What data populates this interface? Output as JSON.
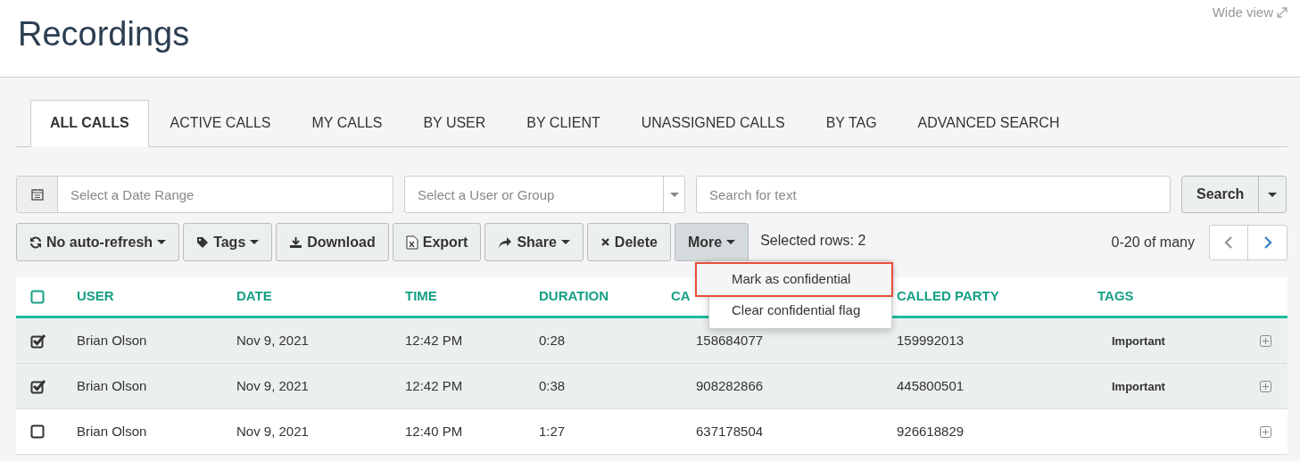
{
  "page": {
    "title": "Recordings",
    "wide_view": "Wide view"
  },
  "tabs": [
    {
      "label": "ALL CALLS",
      "selected": true
    },
    {
      "label": "ACTIVE CALLS",
      "selected": false
    },
    {
      "label": "MY CALLS",
      "selected": false
    },
    {
      "label": "BY USER",
      "selected": false
    },
    {
      "label": "BY CLIENT",
      "selected": false
    },
    {
      "label": "UNASSIGNED CALLS",
      "selected": false
    },
    {
      "label": "BY TAG",
      "selected": false
    },
    {
      "label": "ADVANCED SEARCH",
      "selected": false
    }
  ],
  "filters": {
    "date_range": {
      "placeholder": "Select a Date Range"
    },
    "user_group": {
      "placeholder": "Select a User or Group"
    },
    "text": {
      "placeholder": "Search for text"
    },
    "search_button": "Search"
  },
  "toolbar": [
    {
      "label": "No auto-refresh",
      "kind": "refresh",
      "caret": true,
      "active": false
    },
    {
      "label": "Tags",
      "kind": "tag",
      "caret": true,
      "active": false
    },
    {
      "label": "Download",
      "kind": "download",
      "caret": false,
      "active": false
    },
    {
      "label": "Export",
      "kind": "export",
      "caret": false,
      "active": false
    },
    {
      "label": "Share",
      "kind": "share",
      "caret": true,
      "active": false
    },
    {
      "label": "Delete",
      "kind": "delete",
      "caret": false,
      "active": false
    },
    {
      "label": "More",
      "kind": "more",
      "caret": true,
      "active": true
    }
  ],
  "selected_rows": "Selected rows: 2",
  "pagination": {
    "range": "0-20 of many",
    "prev_disabled": true
  },
  "more_menu": [
    {
      "label": "Mark as confidential",
      "highlighted": true
    },
    {
      "label": "Clear confidential flag",
      "highlighted": false
    }
  ],
  "table": {
    "all_checked": false,
    "columns": [
      "USER",
      "DATE",
      "TIME",
      "DURATION",
      "CA",
      "CALLED PARTY",
      "TAGS"
    ],
    "rows": [
      {
        "checked": true,
        "cells": [
          "Brian Olson",
          "Nov 9, 2021",
          "12:42 PM",
          "0:28",
          "158684077",
          "159992013"
        ],
        "tag": "Important"
      },
      {
        "checked": true,
        "cells": [
          "Brian Olson",
          "Nov 9, 2021",
          "12:42 PM",
          "0:38",
          "908282866",
          "445800501"
        ],
        "tag": "Important"
      },
      {
        "checked": false,
        "cells": [
          "Brian Olson",
          "Nov 9, 2021",
          "12:40 PM",
          "1:27",
          "637178504",
          "926618829"
        ]
      }
    ]
  }
}
